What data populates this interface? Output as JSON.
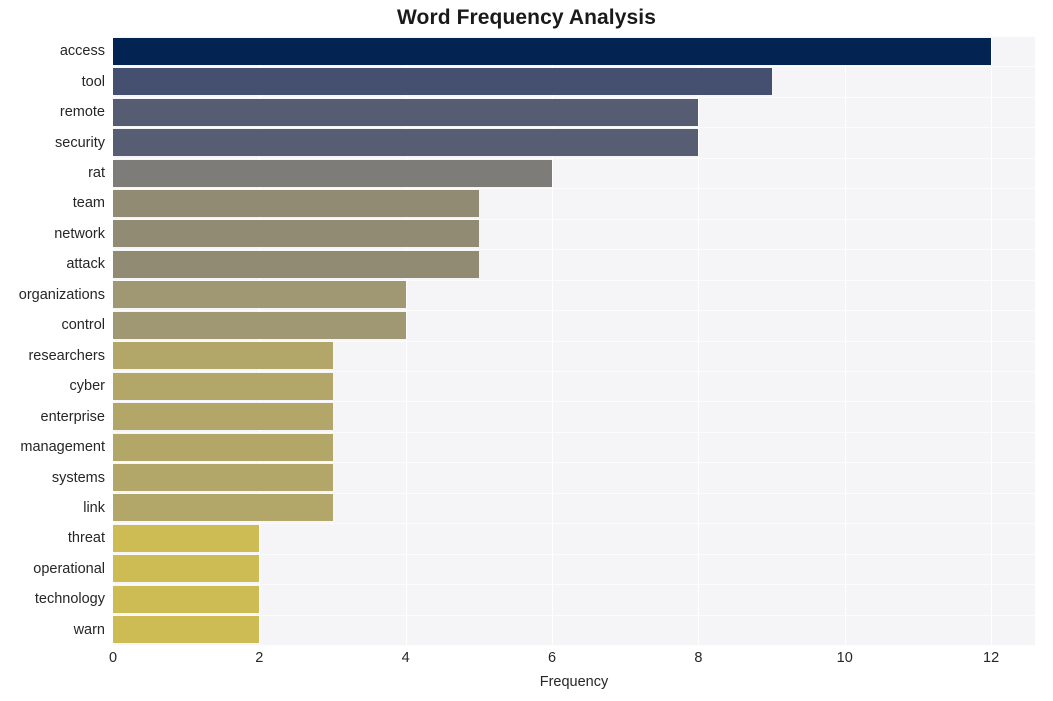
{
  "chart_data": {
    "type": "bar",
    "orientation": "horizontal",
    "title": "Word Frequency Analysis",
    "xlabel": "Frequency",
    "ylabel": "",
    "categories": [
      "access",
      "tool",
      "remote",
      "security",
      "rat",
      "team",
      "network",
      "attack",
      "organizations",
      "control",
      "researchers",
      "cyber",
      "enterprise",
      "management",
      "systems",
      "link",
      "threat",
      "operational",
      "technology",
      "warn"
    ],
    "values": [
      12,
      9,
      8,
      8,
      6,
      5,
      5,
      5,
      4,
      4,
      3,
      3,
      3,
      3,
      3,
      3,
      2,
      2,
      2,
      2
    ],
    "xticks": [
      0,
      2,
      4,
      6,
      8,
      10,
      12
    ],
    "xlim": [
      0,
      12.6
    ],
    "grid": true,
    "legend": null,
    "colormap": "cividis",
    "bar_colors": [
      "#032352",
      "#454f70",
      "#565c72",
      "#575d73",
      "#7d7c78",
      "#918b73",
      "#918b73",
      "#918b73",
      "#a09873",
      "#a09873",
      "#b2a768",
      "#b2a768",
      "#b2a768",
      "#b2a768",
      "#b2a768",
      "#b2a768",
      "#cdbb54",
      "#cdbb54",
      "#cdbb54",
      "#cdbb54"
    ],
    "plot_background": "#f5f5f7",
    "gridline_color": "#ffffff",
    "text_color": "#262626"
  }
}
